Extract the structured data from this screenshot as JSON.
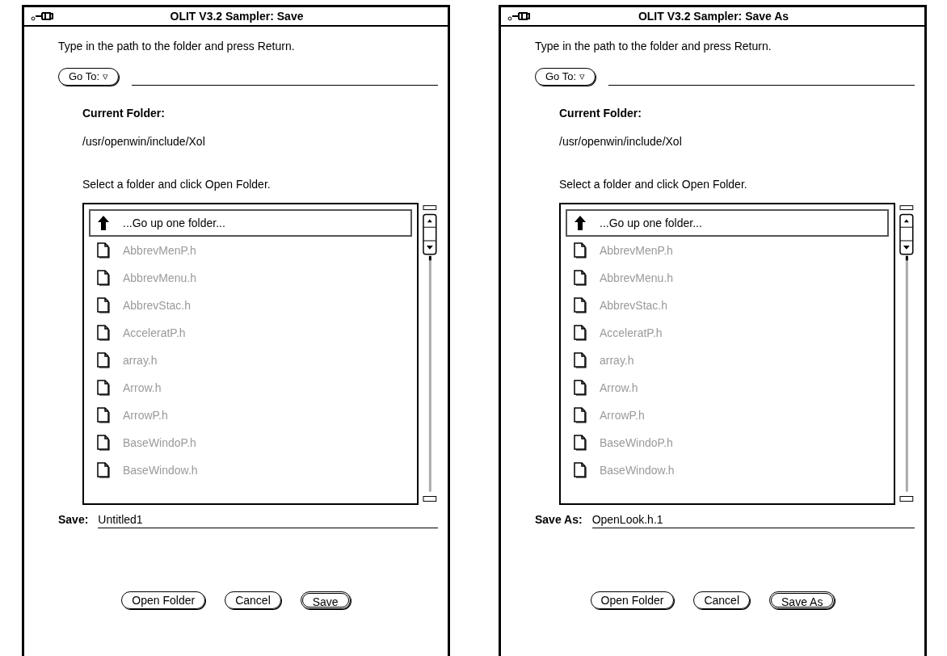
{
  "windows": [
    {
      "title": "OLIT V3.2 Sampler: Save",
      "instruction": "Type in the path to the folder and press Return.",
      "goto_button": "Go To: ▿",
      "current_folder_label": "Current Folder:",
      "current_folder": "/usr/openwin/include/Xol",
      "select_hint": "Select a folder and click Open Folder.",
      "items": [
        {
          "kind": "up",
          "name": "...Go up one folder...",
          "disabled": false,
          "selected": true
        },
        {
          "kind": "file",
          "name": "AbbrevMenP.h",
          "disabled": true,
          "selected": false
        },
        {
          "kind": "file",
          "name": "AbbrevMenu.h",
          "disabled": true,
          "selected": false
        },
        {
          "kind": "file",
          "name": "AbbrevStac.h",
          "disabled": true,
          "selected": false
        },
        {
          "kind": "file",
          "name": "AcceleratP.h",
          "disabled": true,
          "selected": false
        },
        {
          "kind": "file",
          "name": "array.h",
          "disabled": true,
          "selected": false
        },
        {
          "kind": "file",
          "name": "Arrow.h",
          "disabled": true,
          "selected": false
        },
        {
          "kind": "file",
          "name": "ArrowP.h",
          "disabled": true,
          "selected": false
        },
        {
          "kind": "file",
          "name": "BaseWindoP.h",
          "disabled": true,
          "selected": false
        },
        {
          "kind": "file",
          "name": "BaseWindow.h",
          "disabled": true,
          "selected": false
        }
      ],
      "save_label": "Save:",
      "save_value": "Untitled1",
      "buttons": [
        {
          "label": "Open Folder",
          "default": false
        },
        {
          "label": "Cancel",
          "default": false
        },
        {
          "label": "Save",
          "default": true
        }
      ]
    },
    {
      "title": "OLIT V3.2 Sampler: Save As",
      "instruction": "Type in the path to the folder and press Return.",
      "goto_button": "Go To: ▿",
      "current_folder_label": "Current Folder:",
      "current_folder": "/usr/openwin/include/Xol",
      "select_hint": "Select a folder and click Open Folder.",
      "items": [
        {
          "kind": "up",
          "name": "...Go up one folder...",
          "disabled": false,
          "selected": true
        },
        {
          "kind": "file",
          "name": "AbbrevMenP.h",
          "disabled": true,
          "selected": false
        },
        {
          "kind": "file",
          "name": "AbbrevMenu.h",
          "disabled": true,
          "selected": false
        },
        {
          "kind": "file",
          "name": "AbbrevStac.h",
          "disabled": true,
          "selected": false
        },
        {
          "kind": "file",
          "name": "AcceleratP.h",
          "disabled": true,
          "selected": false
        },
        {
          "kind": "file",
          "name": "array.h",
          "disabled": true,
          "selected": false
        },
        {
          "kind": "file",
          "name": "Arrow.h",
          "disabled": true,
          "selected": false
        },
        {
          "kind": "file",
          "name": "ArrowP.h",
          "disabled": true,
          "selected": false
        },
        {
          "kind": "file",
          "name": "BaseWindoP.h",
          "disabled": true,
          "selected": false
        },
        {
          "kind": "file",
          "name": "BaseWindow.h",
          "disabled": true,
          "selected": false
        }
      ],
      "save_label": "Save As:",
      "save_value": "OpenLook.h.1",
      "buttons": [
        {
          "label": "Open Folder",
          "default": false
        },
        {
          "label": "Cancel",
          "default": false
        },
        {
          "label": "Save As",
          "default": true
        }
      ]
    }
  ]
}
